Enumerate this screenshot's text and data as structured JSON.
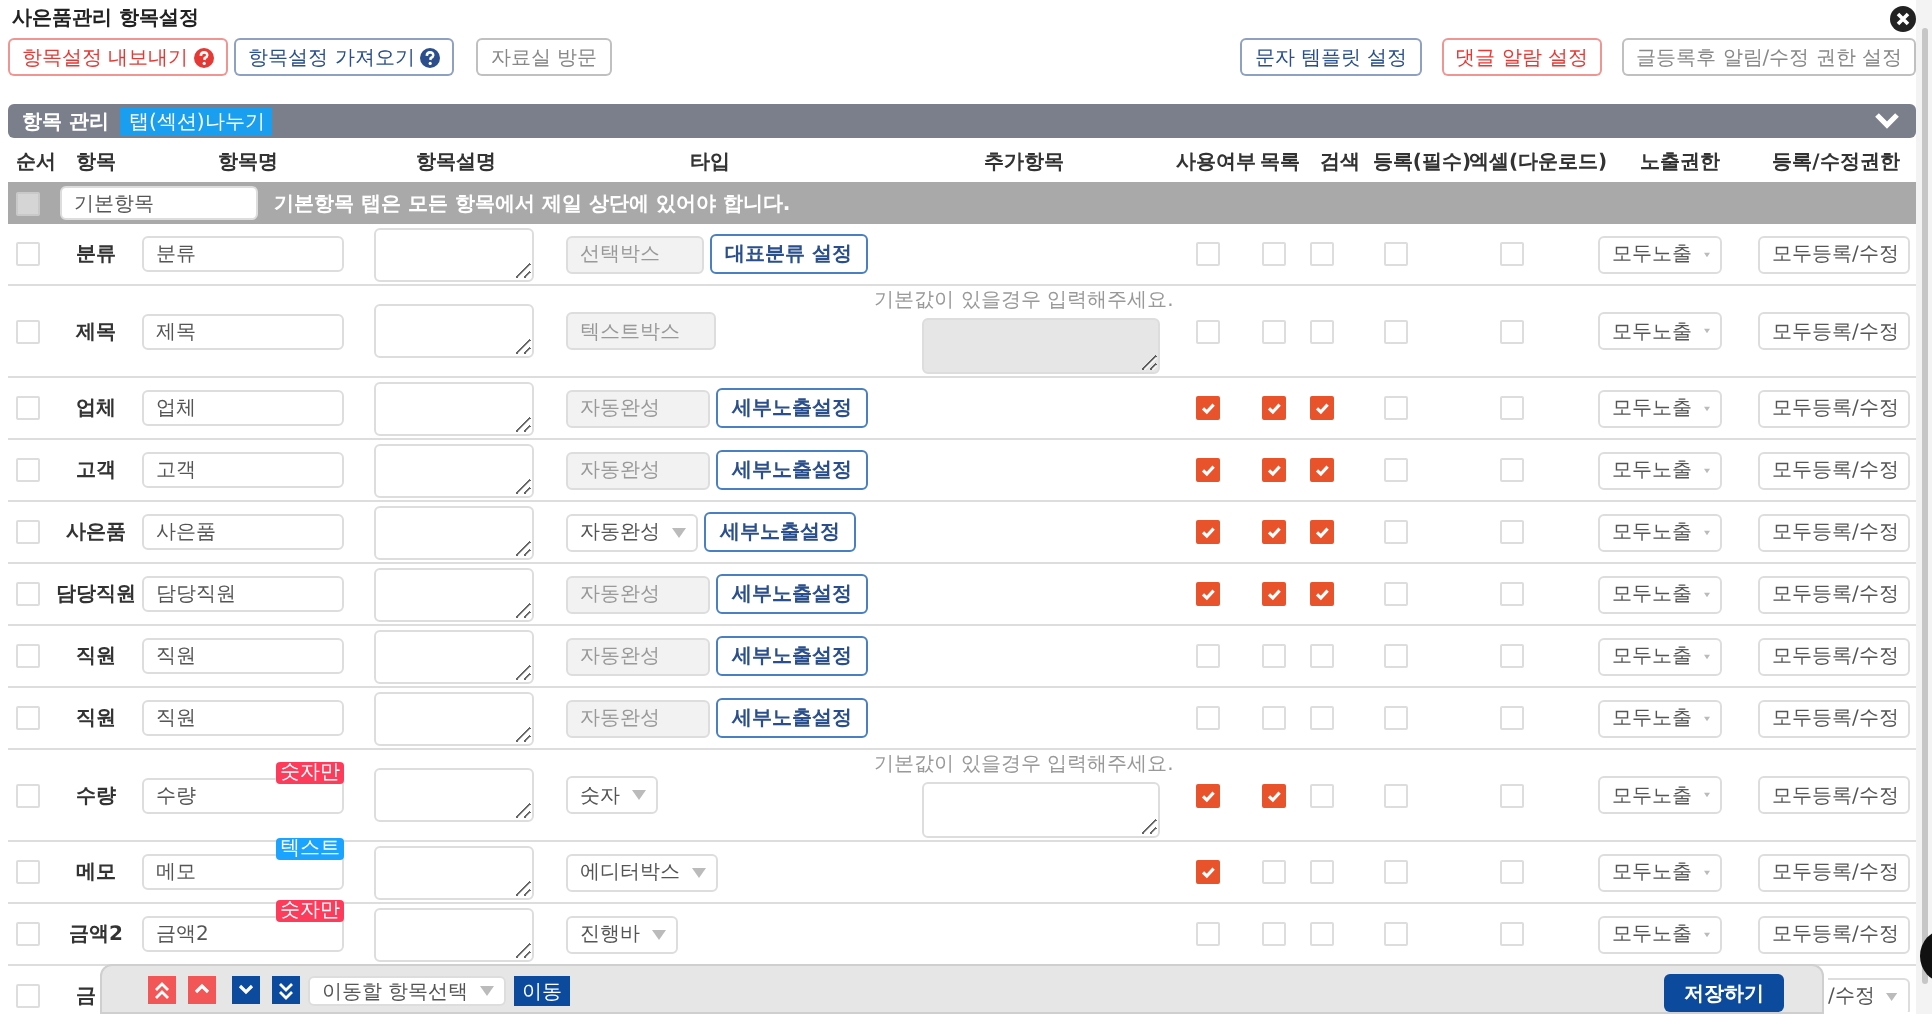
{
  "window": {
    "title": "사은품관리 항목설정"
  },
  "toolbar": {
    "left_buttons": [
      {
        "label": "항목설정 내보내기",
        "color": "#e53935",
        "help": true
      },
      {
        "label": "항목설정 가져오기",
        "color": "#2b4f8c",
        "help": true
      },
      {
        "label": "자료실 방문",
        "color": "#888888",
        "help": false
      }
    ],
    "right_buttons": [
      {
        "label": "문자 템플릿 설정",
        "color": "#2b4f8c",
        "help": false
      },
      {
        "label": "댓글 알람 설정",
        "color": "#e53935",
        "help": false
      },
      {
        "label": "글등록후 알림/수정 권한 설정",
        "color": "#888888",
        "help": false
      }
    ]
  },
  "section": {
    "title": "항목 관리",
    "tab_button": "탭(섹션)나누기"
  },
  "columns": [
    "순서",
    "항목",
    "항목명",
    "항목설명",
    "타입",
    "추가항목",
    "사용여부",
    "목록",
    "검색",
    "등록(필수)",
    "엑셀(다운로드)",
    "노출권한",
    "등록/수정권한"
  ],
  "basic_row": {
    "checked": false,
    "value": "기본항목",
    "note": "기본항목 탭은 모든 항목에서 제일 상단에 있어야 합니다."
  },
  "rows": [
    {
      "kind": "full",
      "checked": false,
      "label": "분류",
      "name": "분류",
      "type": {
        "value": "선택박스",
        "disabled": true
      },
      "type_button": "대표분류 설정",
      "checks": {
        "use": false,
        "list": false,
        "search": false,
        "required": false,
        "excel": false
      },
      "view_perm": "모두노출",
      "edit_perm": "모두등록/수정"
    },
    {
      "kind": "full",
      "checked": false,
      "label": "제목",
      "name": "제목",
      "type": {
        "value": "텍스트박스",
        "disabled": true
      },
      "default_value": {
        "hint": "기본값이 있을경우 입력해주세요.",
        "disabled": true
      },
      "checks": {
        "use": false,
        "list": false,
        "search": false,
        "required": false,
        "excel": false
      },
      "view_perm": "모두노출",
      "edit_perm": "모두등록/수정"
    },
    {
      "kind": "full",
      "checked": false,
      "label": "업체",
      "name": "업체",
      "type": {
        "value": "자동완성",
        "disabled": true
      },
      "type_button": "세부노출설정",
      "checks": {
        "use": true,
        "list": true,
        "search": true,
        "required": false,
        "excel": false
      },
      "view_perm": "모두노출",
      "edit_perm": "모두등록/수정"
    },
    {
      "kind": "full",
      "checked": false,
      "label": "고객",
      "name": "고객",
      "type": {
        "value": "자동완성",
        "disabled": true
      },
      "type_button": "세부노출설정",
      "checks": {
        "use": true,
        "list": true,
        "search": true,
        "required": false,
        "excel": false
      },
      "view_perm": "모두노출",
      "edit_perm": "모두등록/수정"
    },
    {
      "kind": "full",
      "checked": false,
      "label": "사은품",
      "name": "사은품",
      "type": {
        "value": "자동완성",
        "disabled": false
      },
      "type_button": "세부노출설정",
      "checks": {
        "use": true,
        "list": true,
        "search": true,
        "required": false,
        "excel": false
      },
      "view_perm": "모두노출",
      "edit_perm": "모두등록/수정"
    },
    {
      "kind": "full",
      "checked": false,
      "label": "담당직원",
      "name": "담당직원",
      "type": {
        "value": "자동완성",
        "disabled": true
      },
      "type_button": "세부노출설정",
      "checks": {
        "use": true,
        "list": true,
        "search": true,
        "required": false,
        "excel": false
      },
      "view_perm": "모두노출",
      "edit_perm": "모두등록/수정"
    },
    {
      "kind": "full",
      "checked": false,
      "label": "직원",
      "name": "직원",
      "type": {
        "value": "자동완성",
        "disabled": true
      },
      "type_button": "세부노출설정",
      "checks": {
        "use": false,
        "list": false,
        "search": false,
        "required": false,
        "excel": false
      },
      "view_perm": "모두노출",
      "edit_perm": "모두등록/수정"
    },
    {
      "kind": "full",
      "checked": false,
      "label": "직원",
      "name": "직원",
      "type": {
        "value": "자동완성",
        "disabled": true
      },
      "type_button": "세부노출설정",
      "checks": {
        "use": false,
        "list": false,
        "search": false,
        "required": false,
        "excel": false
      },
      "view_perm": "모두노출",
      "edit_perm": "모두등록/수정"
    },
    {
      "kind": "full",
      "checked": false,
      "label": "수량",
      "name": "수량",
      "badge": {
        "text": "숫자만",
        "color": "#ff3b5c"
      },
      "type": {
        "value": "숫자",
        "disabled": false
      },
      "default_value": {
        "hint": "기본값이 있을경우 입력해주세요.",
        "disabled": false
      },
      "checks": {
        "use": true,
        "list": true,
        "search": false,
        "required": false,
        "excel": false
      },
      "view_perm": "모두노출",
      "edit_perm": "모두등록/수정"
    },
    {
      "kind": "full",
      "checked": false,
      "label": "메모",
      "name": "메모",
      "badge": {
        "text": "텍스트",
        "color": "#1aa3ff"
      },
      "type": {
        "value": "에디터박스",
        "disabled": false
      },
      "checks": {
        "use": true,
        "list": false,
        "search": false,
        "required": false,
        "excel": false
      },
      "view_perm": "모두노출",
      "edit_perm": "모두등록/수정"
    },
    {
      "kind": "full",
      "checked": false,
      "label": "금액2",
      "name": "금액2",
      "badge": {
        "text": "숫자만",
        "color": "#ff3b5c"
      },
      "type": {
        "value": "진행바",
        "disabled": false
      },
      "checks": {
        "use": false,
        "list": false,
        "search": false,
        "required": false,
        "excel": false
      },
      "view_perm": "모두노출",
      "edit_perm": "모두등록/수정"
    },
    {
      "kind": "partial",
      "checked": false,
      "label": "금",
      "edit_perm": "/수정"
    }
  ],
  "move_bar": {
    "buttons": [
      {
        "kind": "top"
      },
      {
        "kind": "up"
      },
      {
        "kind": "down"
      },
      {
        "kind": "bottom"
      }
    ],
    "target_select": "이동할 항목선택",
    "move_button": "이동",
    "save_button": "저장하기"
  }
}
